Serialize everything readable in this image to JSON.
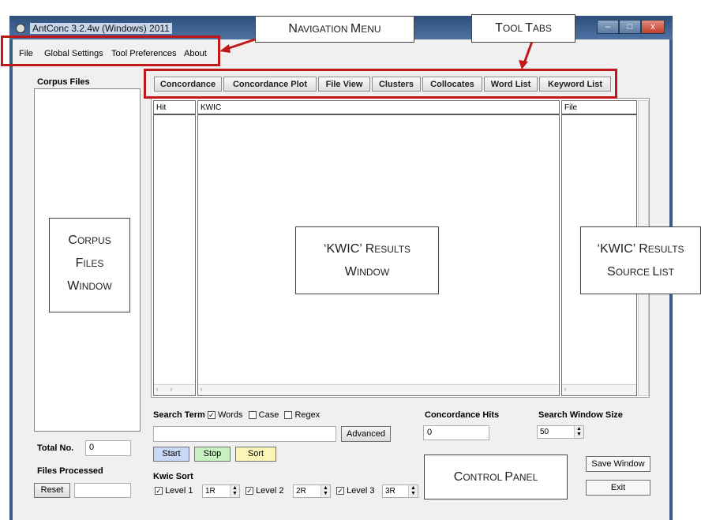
{
  "window": {
    "title": "AntConc 3.2.4w (Windows) 2011",
    "caption_buttons": [
      "–",
      "□",
      "x"
    ]
  },
  "menu": [
    "File",
    "Global Settings",
    "Tool Preferences",
    "About"
  ],
  "corpus": {
    "heading": "Corpus Files",
    "total_label": "Total No.",
    "total_value": "0",
    "files_processed_label": "Files Processed",
    "reset_label": "Reset"
  },
  "tabs": [
    "Concordance",
    "Concordance Plot",
    "File View",
    "Clusters",
    "Collocates",
    "Word List",
    "Keyword List"
  ],
  "results": {
    "col_hit": "Hit",
    "col_kwic": "KWIC",
    "col_file": "File"
  },
  "search": {
    "term_label": "Search Term",
    "opt_words": "Words",
    "opt_case": "Case",
    "opt_regex": "Regex",
    "advanced_label": "Advanced",
    "hits_label": "Concordance Hits",
    "hits_value": "0",
    "window_size_label": "Search Window Size",
    "window_size_value": "50",
    "start_label": "Start",
    "stop_label": "Stop",
    "sort_label": "Sort",
    "save_window_label": "Save Window",
    "exit_label": "Exit"
  },
  "kwic_sort": {
    "heading": "Kwic Sort",
    "levels": [
      {
        "label": "Level 1",
        "value": "1R"
      },
      {
        "label": "Level 2",
        "value": "2R"
      },
      {
        "label": "Level 3",
        "value": "3R"
      }
    ]
  },
  "annotations": {
    "nav_menu": [
      "N",
      "AVIGATION ",
      "M",
      "ENU"
    ],
    "tool_tabs": [
      "T",
      "OOL ",
      "T",
      "ABS"
    ],
    "corpus_window": [
      "C",
      "ORPUS",
      "F",
      "ILES",
      "W",
      "INDOW"
    ],
    "kwic_results": [
      "‘KWIC’ R",
      "ESULTS",
      "W",
      "INDOW"
    ],
    "kwic_source": [
      "‘KWIC’ R",
      "ESULTS",
      "S",
      "OURCE ",
      "L",
      "IST"
    ],
    "control_panel": [
      "C",
      "ONTROL ",
      "P",
      "ANEL"
    ]
  },
  "colors": {
    "annotation_red": "#c0181a",
    "start_button": "#c9d8f6",
    "stop_button": "#c8f0c0",
    "sort_button": "#fbf6b8"
  }
}
